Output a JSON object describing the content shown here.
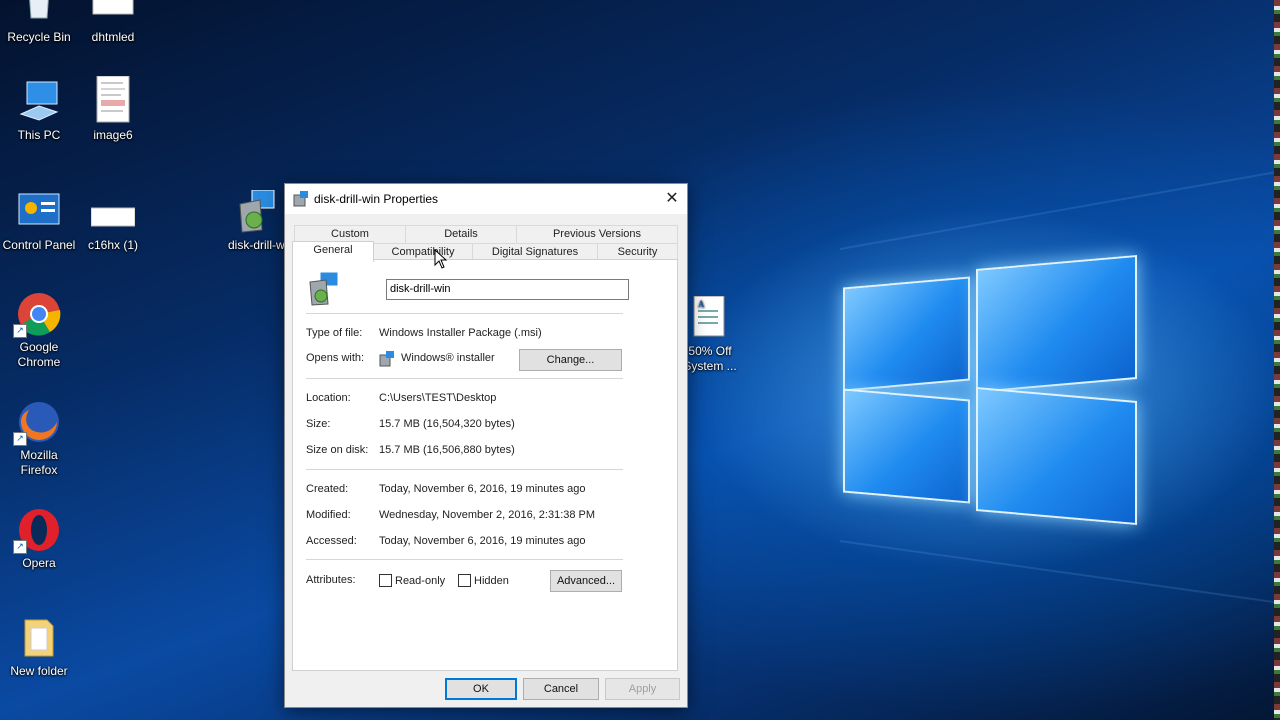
{
  "desktop": {
    "icons": [
      {
        "label": "Recycle Bin"
      },
      {
        "label": "dhtmled"
      },
      {
        "label": "This PC"
      },
      {
        "label": "image6"
      },
      {
        "label": "Control Panel"
      },
      {
        "label": "c16hx (1)"
      },
      {
        "label": "disk-drill-w"
      },
      {
        "label": "Google Chrome"
      },
      {
        "label": "Mozilla Firefox"
      },
      {
        "label": "Opera"
      },
      {
        "label": "New folder"
      },
      {
        "label": "50% Off System ..."
      }
    ]
  },
  "dialog": {
    "title": "disk-drill-win Properties",
    "close_glyph": "✕",
    "tabs_row1": [
      "Custom",
      "Details",
      "Previous Versions"
    ],
    "tabs_row2": [
      "General",
      "Compatibility",
      "Digital Signatures",
      "Security"
    ],
    "selected_tab": "General",
    "file_name": "disk-drill-win",
    "fields": {
      "type_label": "Type of file:",
      "type_value": "Windows Installer Package (.msi)",
      "opens_label": "Opens with:",
      "opens_value": "Windows® installer",
      "change_button": "Change...",
      "location_label": "Location:",
      "location_value": "C:\\Users\\TEST\\Desktop",
      "size_label": "Size:",
      "size_value": "15.7 MB (16,504,320 bytes)",
      "sizedisk_label": "Size on disk:",
      "sizedisk_value": "15.7 MB (16,506,880 bytes)",
      "created_label": "Created:",
      "created_value": "Today, November 6, 2016, 19 minutes ago",
      "modified_label": "Modified:",
      "modified_value": "Wednesday, November 2, 2016, 2:31:38 PM",
      "accessed_label": "Accessed:",
      "accessed_value": "Today, November 6, 2016, 19 minutes ago",
      "attributes_label": "Attributes:",
      "readonly_label": "Read-only",
      "hidden_label": "Hidden",
      "advanced_button": "Advanced..."
    },
    "buttons": {
      "ok": "OK",
      "cancel": "Cancel",
      "apply": "Apply"
    }
  }
}
